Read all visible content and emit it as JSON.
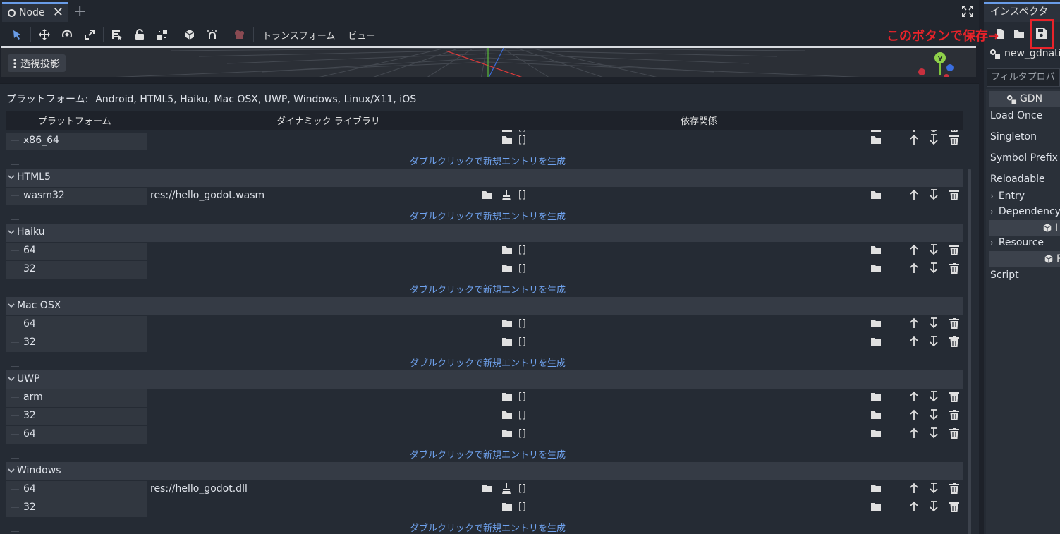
{
  "tabs": {
    "scene_tab_label": "Node",
    "close_symbol": "✕",
    "add_symbol": "+"
  },
  "toolbar": {
    "transform_menu": "トランスフォーム",
    "view_menu": "ビュー"
  },
  "viewport": {
    "perspective_label": "透視投影",
    "gizmo_y_label": "Y"
  },
  "gdnative": {
    "platforms_label": "プラットフォーム:",
    "platforms_value": "Android, HTML5, Haiku, Mac OSX, UWP, Windows, Linux/X11, iOS",
    "columns": {
      "platform": "プラットフォーム",
      "library": "ダイナミック ライブラリ",
      "dependencies": "依存関係"
    },
    "hint": "ダブルクリックで新規エントリを生成",
    "empty_deps": "[]",
    "partial_top_arch": "x86",
    "rows": [
      {
        "type": "arch",
        "name": "x86_64",
        "library": ""
      },
      {
        "type": "hint"
      },
      {
        "type": "group",
        "name": "HTML5"
      },
      {
        "type": "arch",
        "name": "wasm32",
        "library": "res://hello_godot.wasm"
      },
      {
        "type": "hint"
      },
      {
        "type": "group",
        "name": "Haiku"
      },
      {
        "type": "arch",
        "name": "64",
        "library": ""
      },
      {
        "type": "arch",
        "name": "32",
        "library": ""
      },
      {
        "type": "hint"
      },
      {
        "type": "group",
        "name": "Mac OSX"
      },
      {
        "type": "arch",
        "name": "64",
        "library": ""
      },
      {
        "type": "arch",
        "name": "32",
        "library": ""
      },
      {
        "type": "hint"
      },
      {
        "type": "group",
        "name": "UWP"
      },
      {
        "type": "arch",
        "name": "arm",
        "library": ""
      },
      {
        "type": "arch",
        "name": "32",
        "library": ""
      },
      {
        "type": "arch",
        "name": "64",
        "library": ""
      },
      {
        "type": "hint"
      },
      {
        "type": "group",
        "name": "Windows"
      },
      {
        "type": "arch",
        "name": "64",
        "library": "res://hello_godot.dll"
      },
      {
        "type": "arch",
        "name": "32",
        "library": ""
      },
      {
        "type": "hint"
      }
    ]
  },
  "inspector": {
    "tab_label": "インスペクタ",
    "resource_name": "new_gdnati",
    "filter_placeholder": "フィルタプロパ",
    "category_gdn": "GDN",
    "props": {
      "load_once": "Load Once",
      "singleton": "Singleton",
      "symbol_prefix": "Symbol Prefix",
      "reloadable": "Reloadable",
      "script": "Script"
    },
    "sections": {
      "entry": "Entry",
      "dependency": "Dependency",
      "resource": "Resource"
    },
    "category_r1": "I",
    "category_r2": "R"
  },
  "annotation": {
    "text": "このボタンで保存→",
    "color": "#e8232a"
  },
  "colors": {
    "accent": "#699ce8",
    "hint": "#6fa2ee",
    "background": "#252b34"
  }
}
